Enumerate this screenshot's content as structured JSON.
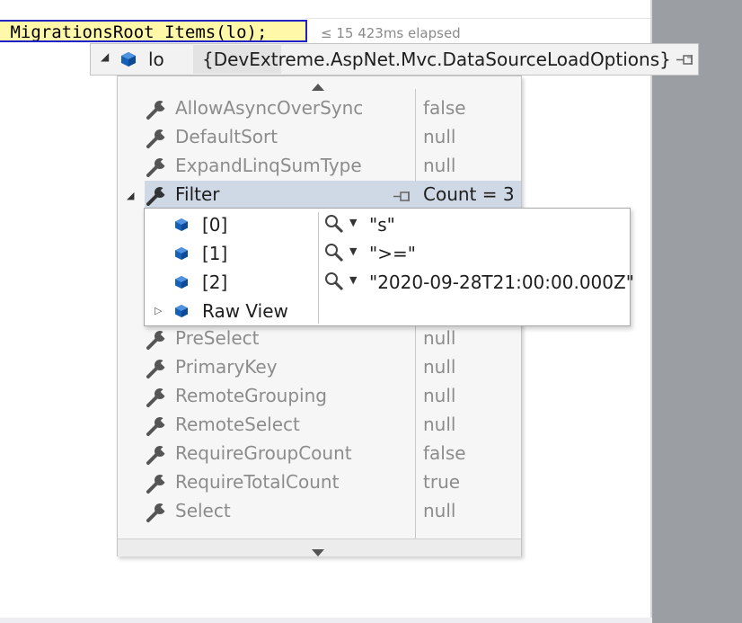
{
  "code": {
    "text": "_MigrationsRoot_Items(lo);"
  },
  "perf_tip": {
    "text": "≤ 15 423ms elapsed"
  },
  "datatip": {
    "name": "lo",
    "value": "{DevExtreme.AspNet.Mvc.DataSourceLoadOptions}"
  },
  "properties": [
    {
      "name": "AllowAsyncOverSync",
      "value": "false"
    },
    {
      "name": "DefaultSort",
      "value": "null"
    },
    {
      "name": "ExpandLinqSumType",
      "value": "null"
    },
    {
      "name": "Filter",
      "value": "Count = 3"
    },
    {
      "name": "PreSelect",
      "value": "null"
    },
    {
      "name": "PrimaryKey",
      "value": "null"
    },
    {
      "name": "RemoteGrouping",
      "value": "null"
    },
    {
      "name": "RemoteSelect",
      "value": "null"
    },
    {
      "name": "RequireGroupCount",
      "value": "false"
    },
    {
      "name": "RequireTotalCount",
      "value": "true"
    },
    {
      "name": "Select",
      "value": "null"
    }
  ],
  "filter_items": [
    {
      "index": "[0]",
      "value": "\"s\""
    },
    {
      "index": "[1]",
      "value": "\">=\""
    },
    {
      "index": "[2]",
      "value": "\"2020-09-28T21:00:00.000Z\""
    },
    {
      "index": "Raw View",
      "value": ""
    }
  ],
  "colors": {
    "highlight": "#fff8a8",
    "selection": "#cfd9e6",
    "accent": "#2020c8"
  }
}
